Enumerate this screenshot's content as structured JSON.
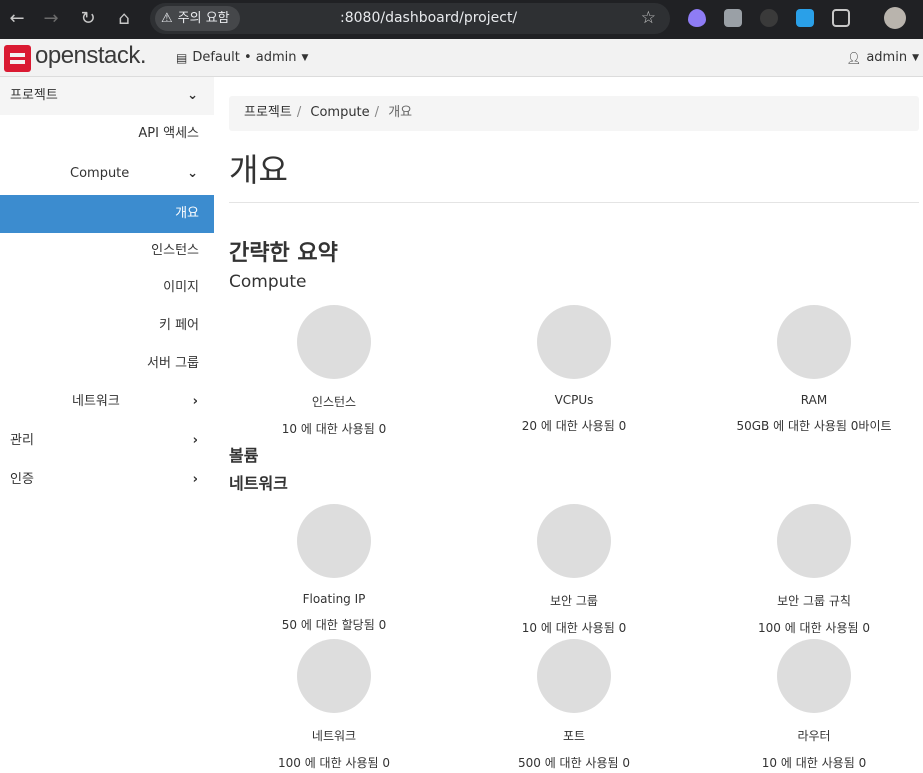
{
  "browser": {
    "warning_label": "주의 요함",
    "url": ":8080/dashboard/project/"
  },
  "header": {
    "brand": "openstack.",
    "project_selector": "Default • admin",
    "user_menu": "admin"
  },
  "sidebar": {
    "sections": [
      {
        "label": "프로젝트"
      },
      {
        "label": "API 액세스"
      },
      {
        "label": "Compute"
      },
      {
        "label": "개요"
      },
      {
        "label": "인스턴스"
      },
      {
        "label": "이미지"
      },
      {
        "label": "키 페어"
      },
      {
        "label": "서버 그룹"
      },
      {
        "label": "네트워크"
      },
      {
        "label": "관리"
      },
      {
        "label": "인증"
      }
    ]
  },
  "breadcrumb": [
    "프로젝트",
    "Compute",
    "개요"
  ],
  "page": {
    "title": "개요",
    "summary_heading": "간략한 요약",
    "compute_heading": "Compute",
    "volume_heading": "볼륨",
    "network_heading": "네트워크"
  },
  "compute_charts": [
    {
      "title": "인스턴스",
      "usage": "10 에 대한 사용됨 0"
    },
    {
      "title": "VCPUs",
      "usage": "20 에 대한 사용됨 0"
    },
    {
      "title": "RAM",
      "usage": "50GB 에 대한 사용됨 0바이트"
    }
  ],
  "network_charts": [
    {
      "title": "Floating IP",
      "usage": "50 에 대한 할당됨 0"
    },
    {
      "title": "보안 그룹",
      "usage": "10 에 대한 사용됨 0"
    },
    {
      "title": "보안 그룹 규칙",
      "usage": "100 에 대한 사용됨 0"
    },
    {
      "title": "네트워크",
      "usage": "100 에 대한 사용됨 0"
    },
    {
      "title": "포트",
      "usage": "500 에 대한 사용됨 0"
    },
    {
      "title": "라우터",
      "usage": "10 에 대한 사용됨 0"
    }
  ],
  "colors": {
    "accent": "#3c8ccf",
    "brand_red": "#da1a32",
    "pie_fill": "#dddddd"
  }
}
